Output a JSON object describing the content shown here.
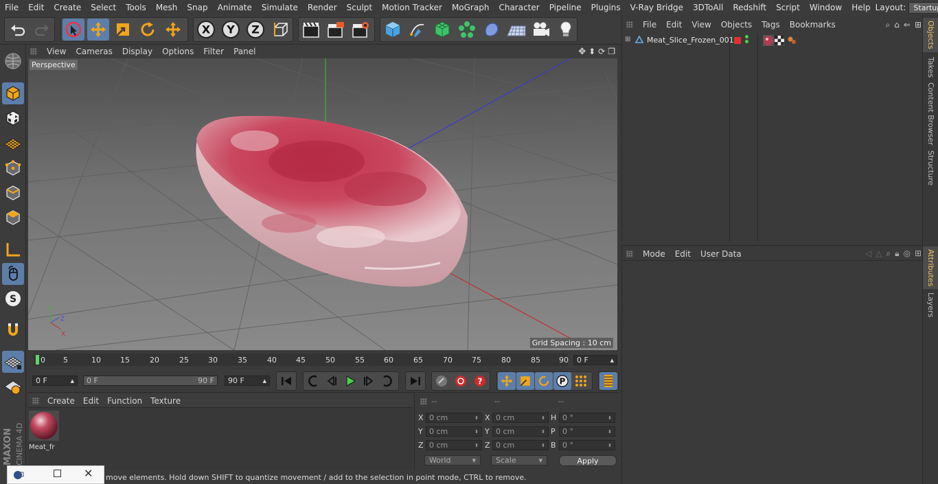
{
  "menubar": {
    "items": [
      "File",
      "Edit",
      "Create",
      "Select",
      "Tools",
      "Mesh",
      "Snap",
      "Animate",
      "Simulate",
      "Render",
      "Sculpt",
      "Motion Tracker",
      "MoGraph",
      "Character",
      "Pipeline",
      "Plugins",
      "V-Ray Bridge",
      "3DToAll",
      "Redshift",
      "Script",
      "Window",
      "Help"
    ],
    "layout_label": "Layout:",
    "layout_value": "Startup"
  },
  "toolbar": {
    "icons": [
      "undo-icon",
      "redo-icon",
      "live-selection-icon",
      "move-icon",
      "scale-icon",
      "rotate-icon",
      "recent-tool-icon",
      "x-axis-lock-icon",
      "y-axis-lock-icon",
      "z-axis-lock-icon",
      "coordinate-system-icon",
      "render-view-icon",
      "render-picture-viewer-icon",
      "edit-render-settings-icon",
      "cube-icon",
      "pen-icon",
      "subdivision-icon",
      "cloner-icon",
      "deformer-icon",
      "floor-icon",
      "camera-icon",
      "light-icon"
    ]
  },
  "viewport": {
    "menu": [
      "View",
      "Cameras",
      "Display",
      "Options",
      "Filter",
      "Panel"
    ],
    "label": "Perspective",
    "grid_spacing": "Grid Spacing : 10 cm"
  },
  "timeline": {
    "ticks": [
      "0",
      "5",
      "10",
      "15",
      "20",
      "25",
      "30",
      "35",
      "40",
      "45",
      "50",
      "55",
      "60",
      "65",
      "70",
      "75",
      "80",
      "85",
      "90"
    ],
    "current_frame": "0 F"
  },
  "playback": {
    "start_frame": "0 F",
    "range_start": "0 F",
    "range_end": "90 F",
    "end_frame": "90 F"
  },
  "material_manager": {
    "menu": [
      "Create",
      "Edit",
      "Function",
      "Texture"
    ],
    "material_name": "Meat_fr"
  },
  "coordinates": {
    "headers": [
      "--",
      "--",
      "--"
    ],
    "pos_labels": [
      "X",
      "Y",
      "Z"
    ],
    "size_labels": [
      "X",
      "Y",
      "Z"
    ],
    "rot_labels": [
      "H",
      "P",
      "B"
    ],
    "pos_values": [
      "0 cm",
      "0 cm",
      "0 cm"
    ],
    "size_values": [
      "0 cm",
      "0 cm",
      "0 cm"
    ],
    "rot_values": [
      "0 °",
      "0 °",
      "0 °"
    ],
    "mode_select": "World",
    "scale_select": "Scale",
    "apply_label": "Apply"
  },
  "status": {
    "text": "move elements. Hold down SHIFT to quantize movement / add to the selection in point mode, CTRL to remove."
  },
  "objects": {
    "menu": [
      "File",
      "Edit",
      "View",
      "Objects",
      "Tags",
      "Bookmarks"
    ],
    "object_name": "Meat_Slice_Frozen_001"
  },
  "attributes": {
    "menu": [
      "Mode",
      "Edit",
      "User Data"
    ]
  },
  "sidetabs": [
    "Objects",
    "Takes",
    "Content Browser",
    "Structure",
    "Attributes",
    "Layers"
  ],
  "branding": {
    "line1": "MAXON",
    "line2": "CINEMA 4D"
  }
}
